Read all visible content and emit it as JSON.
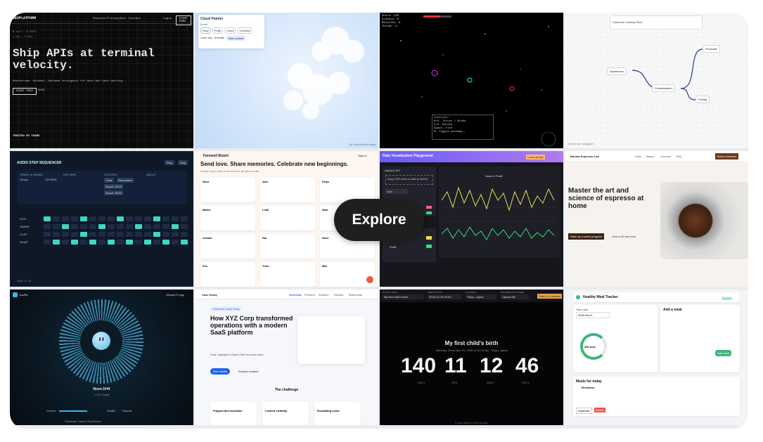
{
  "explore_label": "Explore",
  "t1": {
    "logo": "DEVPLATFORM",
    "nav": [
      "Features",
      "Pricing",
      "Docs",
      "Contact"
    ],
    "login": "Login",
    "cta": "START FREE",
    "code1": "$ curl -X POST",
    "code2": "{'ok': true}",
    "headline": "Ship APIs at terminal velocity.",
    "sub": "Monochrome. Minimal. Maximum throughput for devs who hate waiting.",
    "btn_primary": "START FREE",
    "btn_secondary": "DOCS",
    "trusted": "TRUSTED BY TEAMS"
  },
  "t2": {
    "title": "Cloud Painter",
    "field_label": "Brush",
    "tools": [
      "Wisp",
      "Puffy",
      "Cloud",
      "Cumulus"
    ],
    "opts": [
      "Clear sky",
      "Animate",
      "Save picture"
    ],
    "footer": "Tip: Hold shift to draw"
  },
  "t3": {
    "hud": [
      "Score: 120",
      "Credits: 0",
      "Missiles: 6",
      "Threat: 3"
    ],
    "help": [
      "Controls:",
      "W/S: Thrust / Brake",
      "A/D: Rotate",
      "Space: Fire",
      "M: Toggle minimap"
    ]
  },
  "t4": {
    "title": "Customer Journey Flow",
    "nodes": [
      "Awareness",
      "Consideration",
      "Purchase",
      "Pricing"
    ],
    "footer": "Nodes are draggable"
  },
  "t5": {
    "title": "AUDIO STEP SEQUENCER",
    "btns": [
      "Play",
      "Stop"
    ],
    "sections": [
      "TEMPO & SWING",
      "PATTERN",
      "UTILITIES",
      "ABOUT"
    ],
    "tempo_label": "Tempo",
    "tempo_value": "120 BPM",
    "tracks": [
      "KICK",
      "SNARE",
      "CLAP",
      "HIHAT"
    ],
    "utilities": [
      "Clear",
      "Randomize",
      "Export JSON",
      "Import JSON"
    ],
    "footer": "Step: 0 / 16"
  },
  "t6": {
    "brand": "Farewell Board",
    "signin": "Sign in",
    "headline": "Send love. Share memories. Celebrate new beginnings.",
    "sub": "Leave a kind note or send them off with a smile.",
    "names": [
      "Noor",
      "Alex",
      "Priya",
      "Mateo",
      "Leah",
      "Sam",
      "Jordan",
      "Kai",
      "Noor",
      "Fox",
      "Theo",
      "Mia"
    ]
  },
  "t7": {
    "title": "Data Visualization Playground",
    "btn_sample": "Load sample",
    "upload_title": "Upload CSV",
    "drop": "Drop CSV here or click to select",
    "series": [
      "Sales",
      "Profit"
    ],
    "chart_type": "Line",
    "chart_title": "Sales & Profit"
  },
  "t8": {
    "brand": "Barista Espresso Lab",
    "nav": [
      "Gear",
      "Beans",
      "Courses",
      "FAQ"
    ],
    "cta": "Book a session",
    "headline": "Master the art and science of espresso at home",
    "btn1": "Start my 4-week program",
    "btn2": "View a 30-min intro"
  },
  "t9": {
    "brand": "Lo-Fo",
    "top_right": "Simple-Fo app",
    "track": "Neon Drift",
    "artist": "Lo-Fi Coast",
    "play_icon": "pause",
    "controls": [
      "Volume",
      "Shuffle",
      "Repeat"
    ],
    "shortcuts": "Shortcuts: Space Play/Pause"
  },
  "t10": {
    "brand": "Case Study",
    "tabs": [
      "Overview",
      "Problem",
      "Solution",
      "Results",
      "Testimonial"
    ],
    "pill": "Customer Case Study",
    "headline": "How XYZ Corp transformed operations with a modern SaaS platform",
    "sub": "Goal: highlight a SaaS client success story.",
    "btn1": "See results",
    "btn2": "Explore solution",
    "section": "The challenge",
    "cards": [
      "Fragmented workflow",
      "Limited visibility",
      "Escalating costs"
    ]
  },
  "t11": {
    "labels": [
      "Event name",
      "Date & time",
      "Location",
      "Background image"
    ],
    "field_values": [
      "My first child's birth",
      "2025-12-25 00:00",
      "Tokyo, Japan",
      "Upload file"
    ],
    "btn": "Save to Calendar",
    "title": "My first child's birth",
    "sub": "Saturday, December 29, 2025 at 12:00 AM - Tokyo, Japan",
    "nums": [
      "140",
      "11",
      "12",
      "46"
    ],
    "units": [
      "DAYS",
      "HRS",
      "MINS",
      "SECS"
    ],
    "footer": "Count-down to the big day."
  },
  "t12": {
    "title": "Healthy Meal Tracker",
    "badge": "Synced",
    "start_label": "Start date",
    "start": "2025-06-01",
    "kcal": "450 kcal",
    "add_title": "Add a meal",
    "add_btn": "Add meal",
    "meals_title": "Meals for today",
    "meal": "Breakfast",
    "buttons": [
      "Duplicate",
      "Delete"
    ]
  }
}
